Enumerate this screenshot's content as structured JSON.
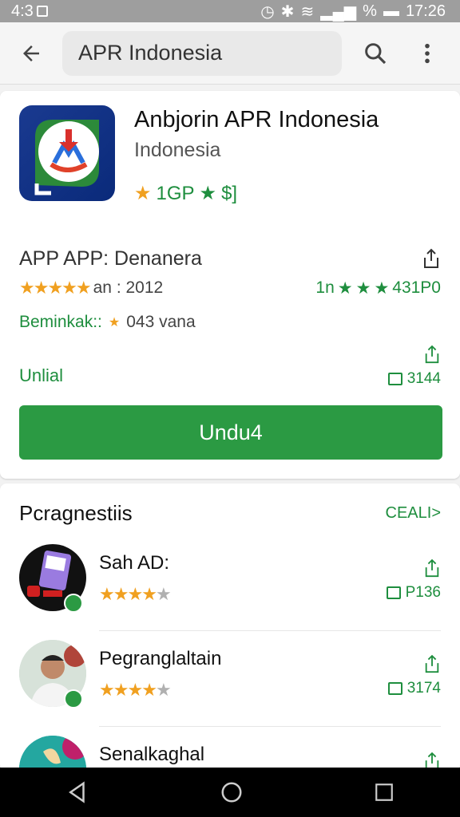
{
  "status_bar": {
    "time": "4:3",
    "right_time": "17:26",
    "indicators": "%"
  },
  "app_bar": {
    "search_text": "APR Indonesia"
  },
  "app": {
    "title": "Anbjorin APR Indonesia",
    "developer": "Indonesia",
    "rating_line": "1GP",
    "rating_tail": "$]",
    "info_label": "APP APP: Denanera",
    "stars_row": "★★★★★",
    "meta_year": "an : 2012",
    "meta_right": "1n",
    "meta_right_count": "431P0",
    "downloads_label": "Beminkak::",
    "downloads_value": "043 vana",
    "update_label": "Unlial",
    "update_size": "3144",
    "install_label": "Undu4"
  },
  "section": {
    "title": "Pcragnestiis",
    "see_all": "CEALI>"
  },
  "items": [
    {
      "name": "Sah AD:",
      "size": "P136"
    },
    {
      "name": "Pegranglaltain",
      "size": "3174"
    },
    {
      "name": "Senalkaghal",
      "size": ""
    }
  ],
  "colors": {
    "accent": "#2b9a43",
    "star": "#f0a020",
    "green_text": "#1e8e3e"
  }
}
